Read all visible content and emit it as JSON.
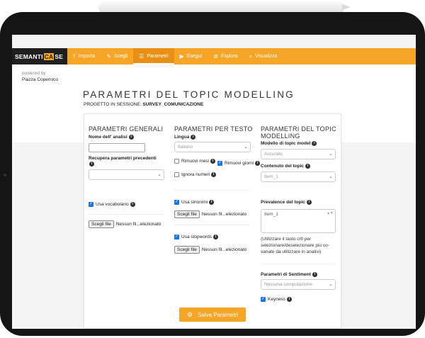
{
  "nav": {
    "brand_pre": "SEMANTI",
    "brand_ca": "CA",
    "brand_post": "SE",
    "items": [
      {
        "icon": "upload-icon",
        "glyph": "⤒",
        "label": "Importa"
      },
      {
        "icon": "wand-icon",
        "glyph": "✎",
        "label": "Scegli"
      },
      {
        "icon": "sliders-icon",
        "glyph": "☰",
        "label": "Parametri"
      },
      {
        "icon": "play-icon",
        "glyph": "▶",
        "label": "Esegui"
      },
      {
        "icon": "compass-icon",
        "glyph": "⊘",
        "label": "Esplora"
      },
      {
        "icon": "search-icon",
        "glyph": "⌕",
        "label": "Visualizza"
      }
    ],
    "accent": "#f6a527"
  },
  "header": {
    "powered_by": "powered by",
    "company": "Piazza Copernico",
    "title": "PARAMETRI DEL TOPIC MODELLING",
    "project_label": "PROGETTO IN SESSIONE:",
    "project_name": "SURVEY_COMUNICAZIONE"
  },
  "general": {
    "title": "PARAMETRI GENERALI",
    "analysis_name_label": "Nome dell' analisi",
    "analysis_name_value": "",
    "recover_label": "Recupera parametri precedenti",
    "recover_value": "",
    "vocab_label": "Usa vocabolario",
    "vocab_checked": true,
    "file_button": "Scegli file",
    "file_status": "Nessun fil...elezionato"
  },
  "text": {
    "title": "PARAMETRI PER TESTO",
    "language_label": "Lingua",
    "language_value": "Italiano",
    "remove_months_label": "Rimuovi mesi",
    "remove_months_checked": false,
    "remove_days_label": "Rimuovi giorni",
    "remove_days_checked": true,
    "ignore_numbers_label": "Ignora numeri",
    "ignore_numbers_checked": false,
    "synonyms_label": "Usa sinonimi",
    "synonyms_checked": true,
    "synonyms_file_button": "Scegli file",
    "synonyms_file_status": "Nessun fil...elezionato",
    "stopwords_label": "Usa stopwords",
    "stopwords_checked": true,
    "stopwords_file_button": "Scegli file",
    "stopwords_file_status": "Nessun fil...elezionato"
  },
  "topic": {
    "title": "PARAMETRI DEL TOPIC MODELLING",
    "model_label": "Modello di topic model",
    "model_value": "Accurato",
    "content_label": "Contenuto del topic",
    "content_value": "Item_1",
    "prevalence_label": "Prevalence del topic",
    "prevalence_value": "Item_1",
    "prevalence_note": "(Utilizzare il tasto crtl per selezionare/deselezionare più co-variate da utilizzare in analisi)",
    "sentiment_label": "Parametri di Sentiment",
    "sentiment_value": "Nessuna computazione",
    "keyness_label": "Keyness",
    "keyness_checked": true
  },
  "save_label": "Salva Parametri",
  "info_glyph": "i",
  "check_glyph": "✓",
  "chevron_glyph": "⌄",
  "grip_glyph": "▲▼"
}
